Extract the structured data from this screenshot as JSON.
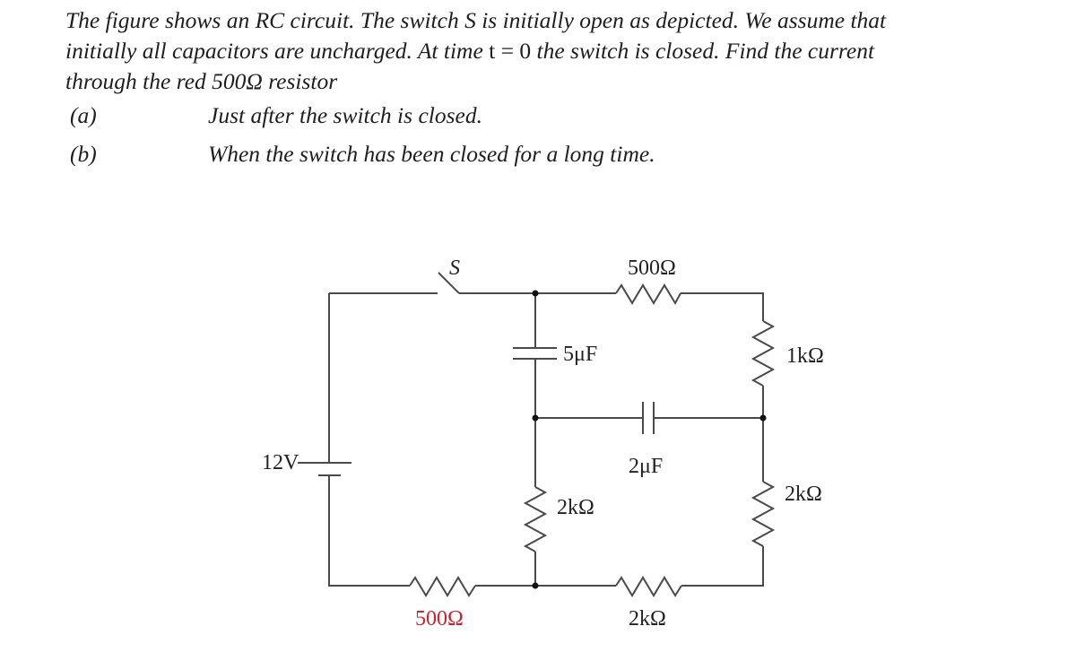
{
  "problem": {
    "line1": "The figure shows an RC circuit. The switch S is initially open as depicted. We assume that",
    "line2_a": "initially all capacitors are uncharged. At time ",
    "line2_math": "t = 0",
    "line2_b": " the switch is closed. Find the current",
    "line3": "through the red 500Ω resistor"
  },
  "parts": [
    {
      "label": "(a)",
      "text": "Just after the switch is closed."
    },
    {
      "label": "(b)",
      "text": "When the switch has been closed for a long time."
    }
  ],
  "circuit": {
    "switch_label": "S",
    "battery_label": "12V",
    "components": {
      "top_resistor": "500Ω",
      "cap_5uF": "5μF",
      "right_top_resistor": "1kΩ",
      "cap_2uF": "2μF",
      "middle_resistor": "2kΩ",
      "right_bottom_resistor": "2kΩ",
      "bottom_left_resistor": "500Ω",
      "bottom_right_resistor": "2kΩ"
    },
    "colors": {
      "highlight_resistor": "#d0202e",
      "wire": "#4a4a4a"
    }
  }
}
